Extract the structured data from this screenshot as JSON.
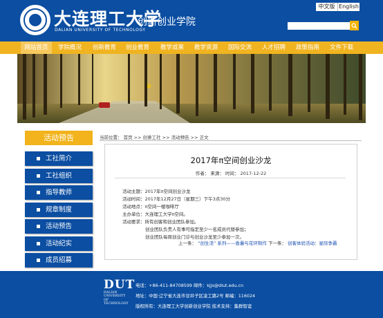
{
  "header": {
    "university_cn": "大连理工大学",
    "university_en": "DALIAN UNIVERSITY OF TECHNOLOGY",
    "college": "创新创业学院",
    "lang_cn": "中文版",
    "lang_en": "English",
    "search_placeholder": "",
    "search_icon": "search-icon"
  },
  "nav": {
    "items": [
      "网站首页",
      "学院概况",
      "创新教育",
      "创业教育",
      "教学成果",
      "教学资源",
      "国际交流",
      "人才招聘",
      "政策指南",
      "文件下载"
    ]
  },
  "sidebar": {
    "title": "活动预告",
    "items": [
      "工社简介",
      "工社组织",
      "指导教师",
      "规章制度",
      "活动预告",
      "活动纪实",
      "成员招募"
    ]
  },
  "breadcrumb": {
    "text": "当前位置：  首页  >>  创意工社  >>  活动预告  >>  正文"
  },
  "article": {
    "title": "2017年π空间创业沙龙",
    "meta": "作者：   来源：   时间：  2017-12-22",
    "lines": [
      "活动主题：2017年π空间创业沙龙",
      "活动时间：2017年12月27日（星期三）下午3点30分",
      "活动地点：π空间一楼咖啡厅",
      "主办单位：大连理工大学π空间。",
      "活动要求：所有创客和创业团队参加。",
      "创业团队负责人有事可指定至少一名成员代替参加；",
      "创业团队每周创业门诊与创业沙龙至少参加一次。"
    ],
    "prev_label": "上一条：",
    "prev_link": "“创生活” 系列——香囊与花环制作",
    "next_label": "下一条：",
    "next_link": "创客体验活动：星际争霸"
  },
  "footer": {
    "logo_big": "DUT",
    "logo_small": [
      "DALIAN",
      "UNIVERSITY OF",
      "TECHNOLOGY"
    ],
    "line1": "电话：+86-411-84708599 邮件：kjjs@dlut.edu.cn",
    "line2": "地址：中国·辽宁省大连市甘井子区凌工路2号 邮编：116024",
    "line3": "版权所有：大连理工大学创新创业学院 技术支持：集群智谊"
  },
  "colors": {
    "brand_blue": "#0b4ea2",
    "accent_gold": "#f0b420",
    "link_blue": "#1a4fb0"
  }
}
